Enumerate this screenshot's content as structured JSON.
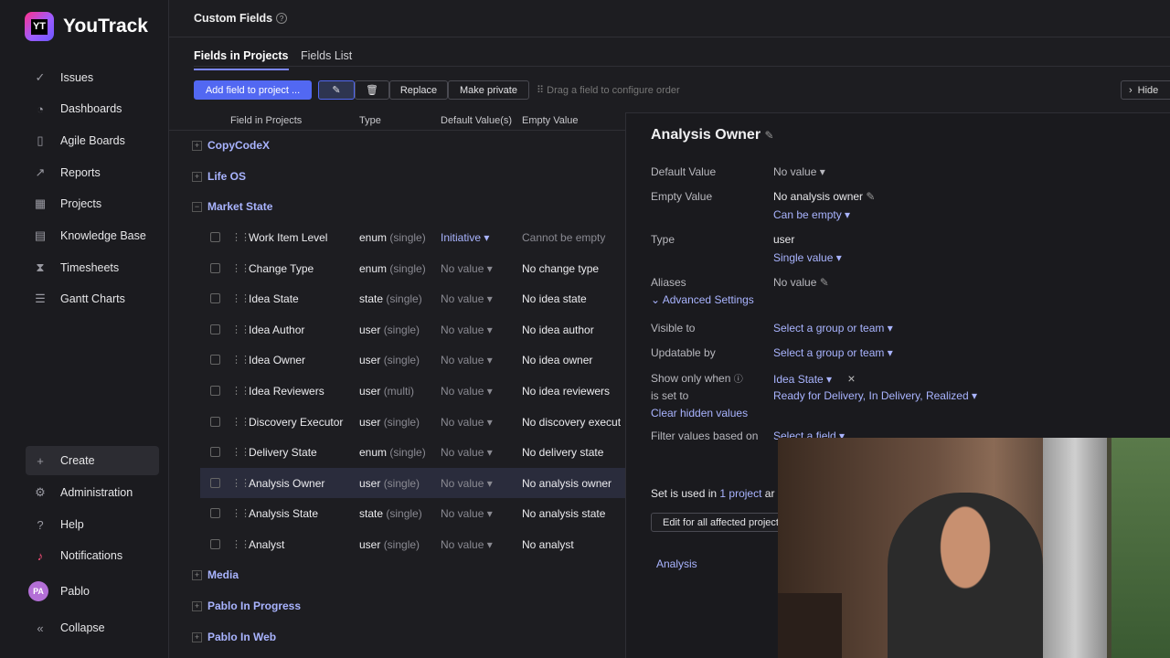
{
  "app": {
    "name": "YouTrack",
    "logo_mark": "YT"
  },
  "sidebar": {
    "items": [
      {
        "label": "Issues",
        "icon": "issues-icon"
      },
      {
        "label": "Dashboards",
        "icon": "dashboards-icon"
      },
      {
        "label": "Agile Boards",
        "icon": "agile-boards-icon"
      },
      {
        "label": "Reports",
        "icon": "reports-icon"
      },
      {
        "label": "Projects",
        "icon": "projects-icon"
      },
      {
        "label": "Knowledge Base",
        "icon": "knowledge-base-icon"
      },
      {
        "label": "Timesheets",
        "icon": "timesheets-icon"
      },
      {
        "label": "Gantt Charts",
        "icon": "gantt-charts-icon"
      }
    ],
    "bottom": [
      {
        "label": "Create",
        "icon": "plus-icon"
      },
      {
        "label": "Administration",
        "icon": "gear-icon"
      },
      {
        "label": "Help",
        "icon": "help-icon"
      },
      {
        "label": "Notifications",
        "icon": "bell-icon"
      }
    ],
    "user": {
      "initials": "PA",
      "name": "Pablo"
    },
    "collapse_label": "Collapse"
  },
  "header": {
    "title": "Custom Fields"
  },
  "tabs": [
    {
      "label": "Fields in Projects",
      "active": true
    },
    {
      "label": "Fields List",
      "active": false
    }
  ],
  "toolbar": {
    "add_label": "Add field to project ...",
    "replace_label": "Replace",
    "make_private_label": "Make private",
    "drag_hint": "Drag a field to configure order",
    "hide_label": "Hide"
  },
  "columns": {
    "field": "Field in Projects",
    "type": "Type",
    "default": "Default Value(s)",
    "empty": "Empty Value"
  },
  "projects": [
    {
      "name": "CopyCodeX",
      "expanded": false
    },
    {
      "name": "Life OS",
      "expanded": false
    },
    {
      "name": "Market State",
      "expanded": true
    },
    {
      "name": "Media",
      "expanded": false
    },
    {
      "name": "Pablo In Progress",
      "expanded": false
    },
    {
      "name": "Pablo In Web",
      "expanded": false
    }
  ],
  "fields": [
    {
      "name": "Work Item Level",
      "type": "enum",
      "card": "(single)",
      "default": "Initiative",
      "empty": "Cannot be empty"
    },
    {
      "name": "Change Type",
      "type": "enum",
      "card": "(single)",
      "default": "No value",
      "empty": "No change type"
    },
    {
      "name": "Idea State",
      "type": "state",
      "card": "(single)",
      "default": "No value",
      "empty": "No idea state"
    },
    {
      "name": "Idea Author",
      "type": "user",
      "card": "(single)",
      "default": "No value",
      "empty": "No idea author"
    },
    {
      "name": "Idea Owner",
      "type": "user",
      "card": "(single)",
      "default": "No value",
      "empty": "No idea owner"
    },
    {
      "name": "Idea Reviewers",
      "type": "user",
      "card": "(multi)",
      "default": "No value",
      "empty": "No idea reviewers"
    },
    {
      "name": "Discovery Executor",
      "type": "user",
      "card": "(single)",
      "default": "No value",
      "empty": "No discovery execut"
    },
    {
      "name": "Delivery State",
      "type": "enum",
      "card": "(single)",
      "default": "No value",
      "empty": "No delivery state"
    },
    {
      "name": "Analysis Owner",
      "type": "user",
      "card": "(single)",
      "default": "No value",
      "empty": "No analysis owner"
    },
    {
      "name": "Analysis State",
      "type": "state",
      "card": "(single)",
      "default": "No value",
      "empty": "No analysis state"
    },
    {
      "name": "Analyst",
      "type": "user",
      "card": "(single)",
      "default": "No value",
      "empty": "No analyst"
    }
  ],
  "panel": {
    "title": "Analysis Owner",
    "default_label": "Default Value",
    "default_value": "No value",
    "empty_label": "Empty Value",
    "empty_value": "No analysis owner",
    "can_be_empty": "Can be empty",
    "type_label": "Type",
    "type_value": "user",
    "cardinality": "Single value",
    "aliases_label": "Aliases",
    "aliases_value": "No value",
    "advanced": "Advanced Settings",
    "visible_label": "Visible to",
    "visible_value": "Select a group or team",
    "updatable_label": "Updatable by",
    "updatable_value": "Select a group or team",
    "show_when_label": "Show only when",
    "show_when_value": "Idea State",
    "is_set_label": "is set to",
    "is_set_value": "Ready for Delivery, In Delivery, Realized",
    "clear_hidden": "Clear hidden values",
    "filter_label": "Filter values based on",
    "filter_value": "Select a field",
    "used_in_prefix": "Set is used in",
    "used_in_link": "1 project",
    "used_in_suffix": "ar",
    "edit_all": "Edit for all affected project",
    "project_link": "Analysis"
  }
}
